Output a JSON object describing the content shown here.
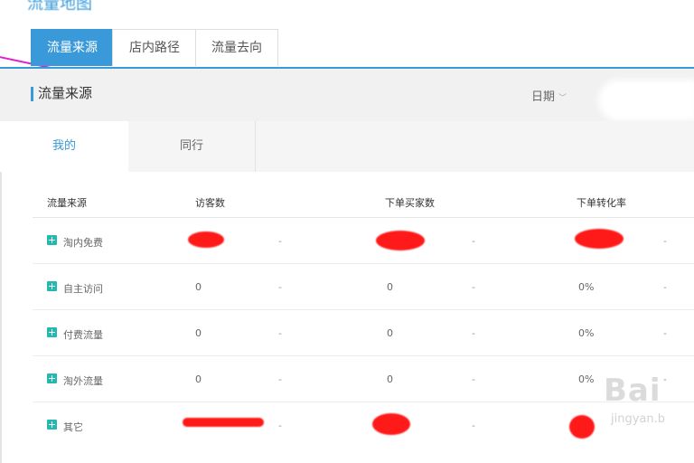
{
  "page_title": "流量地图",
  "main_tabs": [
    {
      "label": "流量来源",
      "active": true
    },
    {
      "label": "店内路径",
      "active": false
    },
    {
      "label": "流量去向",
      "active": false
    }
  ],
  "section": {
    "title": "流量来源",
    "date_label": "日期"
  },
  "sub_tabs": [
    {
      "label": "我的",
      "active": true
    },
    {
      "label": "同行",
      "active": false
    }
  ],
  "table": {
    "headers": [
      "流量来源",
      "访客数",
      "下单买家数",
      "下单转化率"
    ],
    "rows": [
      {
        "source": "淘内免费",
        "visitors": "",
        "buyers": "",
        "rate": "",
        "dash": "-"
      },
      {
        "source": "自主访问",
        "visitors": "0",
        "buyers": "0",
        "rate": "0%",
        "dash": "-"
      },
      {
        "source": "付费流量",
        "visitors": "0",
        "buyers": "0",
        "rate": "0%",
        "dash": "-"
      },
      {
        "source": "淘外流量",
        "visitors": "0",
        "buyers": "0",
        "rate": "0%",
        "dash": "-"
      },
      {
        "source": "其它",
        "visitors": "",
        "buyers": "",
        "rate": "",
        "dash": "-"
      }
    ]
  },
  "watermark": {
    "text": "Bai",
    "sub": "jingyan.b"
  },
  "colors": {
    "accent": "#3a9ad9",
    "expand_icon": "#23b8b0",
    "redaction": "#ff1a1a"
  }
}
